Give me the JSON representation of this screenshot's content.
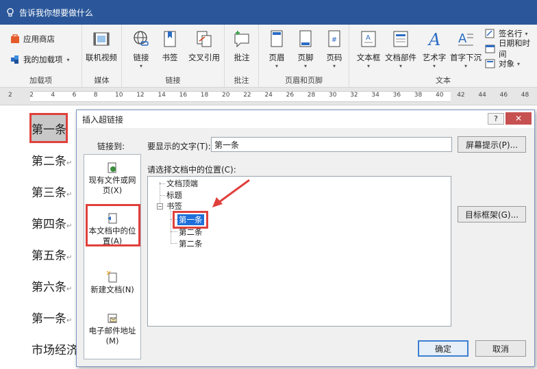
{
  "tellme": {
    "text": "告诉我你想要做什么"
  },
  "ribbon": {
    "addins": {
      "label": "加载项",
      "store": "应用商店",
      "my_addins": "我的加载项"
    },
    "media": {
      "label": "媒体",
      "online_video": "联机视频"
    },
    "links": {
      "label": "链接",
      "link": "链接",
      "bookmark": "书签",
      "cross_ref": "交叉引用"
    },
    "comments": {
      "label": "批注",
      "comment": "批注"
    },
    "header_footer": {
      "label": "页眉和页脚",
      "header": "页眉",
      "footer": "页脚",
      "page_number": "页码"
    },
    "text": {
      "label": "文本",
      "text_box": "文本框",
      "quick_parts": "文档部件",
      "wordart": "艺术字",
      "drop_cap": "首字下沉",
      "signature": "签名行",
      "datetime": "日期和时间",
      "object": "对象"
    }
  },
  "ruler": {
    "ticks": [
      "2",
      "2",
      "4",
      "6",
      "8",
      "10",
      "12",
      "14",
      "16",
      "18",
      "20",
      "22",
      "24",
      "26",
      "28",
      "30",
      "32",
      "34",
      "36",
      "38",
      "40",
      "42",
      "44",
      "46",
      "48"
    ]
  },
  "document": {
    "lines": [
      "第一条",
      "第二条",
      "第三条",
      "第四条",
      "第五条",
      "第六条",
      "第一条",
      "市场经济"
    ],
    "para_mark": "↵"
  },
  "dialog": {
    "title": "插入超链接",
    "help": "?",
    "close": "✕",
    "link_to_label": "链接到:",
    "link_to": [
      {
        "label": "现有文件或网页(X)"
      },
      {
        "label": "本文档中的位置(A)"
      },
      {
        "label": "新建文档(N)"
      },
      {
        "label": "电子邮件地址(M)"
      }
    ],
    "display_text_label": "要显示的文字(T):",
    "display_text_value": "第一条",
    "screentip_button": "屏幕提示(P)...",
    "select_place_label": "请选择文档中的位置(C):",
    "tree": {
      "top": "文档顶端",
      "headings": "标题",
      "bookmarks": "书签",
      "bookmark_items": [
        "第一条",
        "第二条",
        "第二条"
      ]
    },
    "target_frame_button": "目标框架(G)...",
    "ok_button": "确定",
    "cancel_button": "取消"
  },
  "colors": {
    "title_bar": "#2b579a",
    "highlight": "#e0403c",
    "selection": "#1e6fd9"
  }
}
